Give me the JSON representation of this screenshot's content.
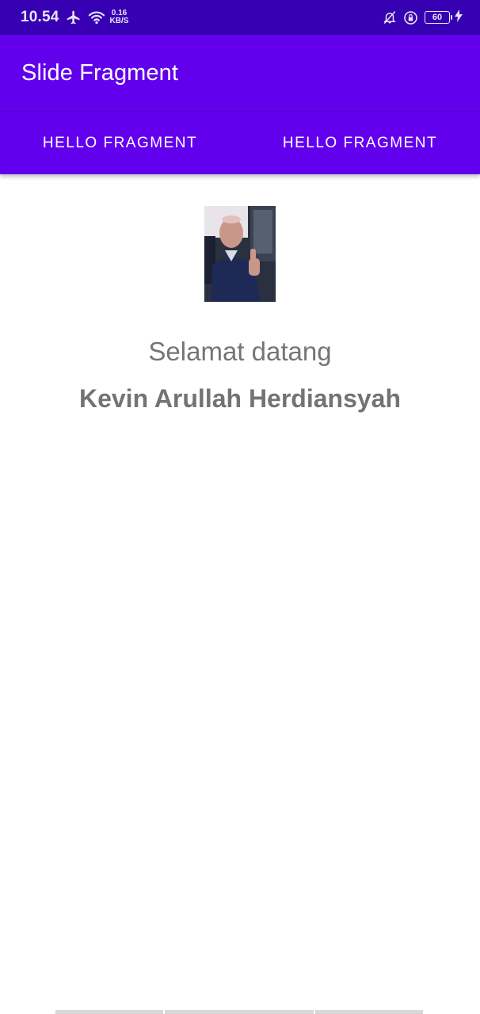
{
  "status_bar": {
    "time": "10.54",
    "net_speed_value": "0.16",
    "net_speed_unit": "KB/S",
    "battery": "60",
    "icons": [
      "airplane-icon",
      "wifi-icon",
      "mute-bell-icon",
      "lock-rotation-icon",
      "battery-icon",
      "charging-bolt-icon"
    ]
  },
  "app_bar": {
    "title": "Slide Fragment"
  },
  "tabs": [
    {
      "label": "HELLO FRAGMENT"
    },
    {
      "label": "HELLO FRAGMENT"
    }
  ],
  "content": {
    "welcome": "Selamat datang",
    "name": "Kevin Arullah Herdiansyah"
  },
  "colors": {
    "status_bar": "#3700b3",
    "primary": "#6200ee",
    "text_gray": "#757575"
  }
}
